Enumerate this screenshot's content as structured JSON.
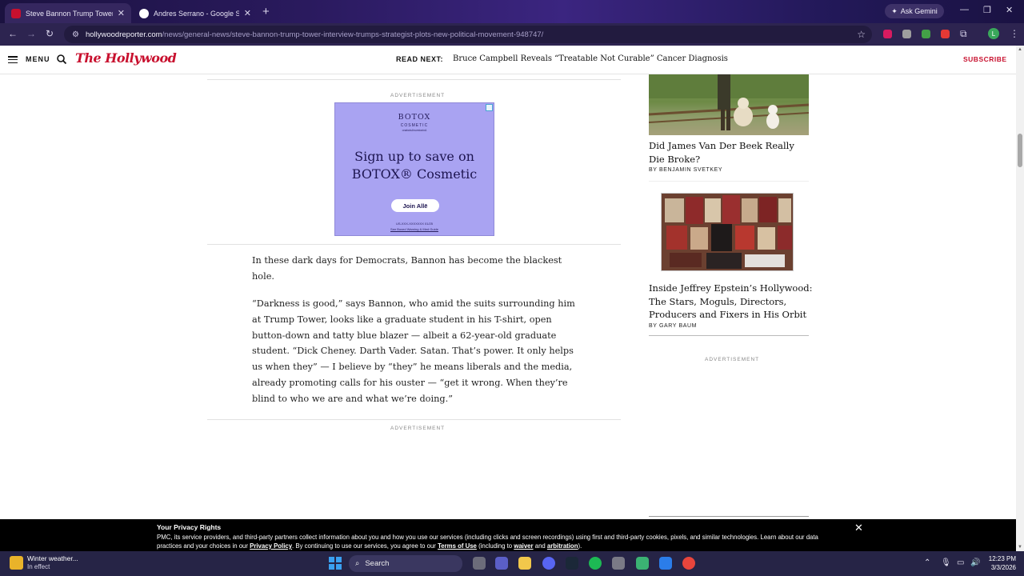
{
  "browser": {
    "tabs": [
      {
        "title": "Steve Bannon Trump Tower Inte",
        "active": true,
        "favicon_color": "#c8102e"
      },
      {
        "title": "Andres Serrano - Google Searc",
        "active": false,
        "favicon_color": "#4285f4"
      }
    ],
    "new_tab": "+",
    "gemini_label": "Ask Gemini",
    "url_domain": "hollywoodreporter.com",
    "url_path": "/news/general-news/steve-bannon-trump-tower-interview-trumps-strategist-plots-new-political-movement-948747/",
    "profile_initial": "L"
  },
  "site": {
    "menu_label": "MENU",
    "logo_text": "The Hollywood",
    "read_next_label": "READ NEXT:",
    "read_next_title": "Bruce Campbell Reveals “Treatable Not Curable” Cancer Diagnosis",
    "subscribe_label": "SUBSCRIBE"
  },
  "ad": {
    "label": "ADVERTISEMENT",
    "brand": "BOTOX",
    "brand_sub": "COSMETIC",
    "brand_fine": "onabotulinumtoxinA",
    "headline_line1": "Sign up to save on",
    "headline_line2": "BOTOX® Cosmetic",
    "cta": "Join Allē",
    "fine1": "US-XXX-XXXXXXX 01/25",
    "fine2": "See Boxed Warning & Med Guide"
  },
  "article": {
    "paragraphs": [
      "In these dark days for Democrats, Bannon has become the blackest hole.",
      "“Darkness is good,” says Bannon, who amid the suits surrounding him at Trump Tower, looks like a graduate student in his T-shirt, open button-down and tatty blue blazer — albeit a 62-year-old graduate student. “Dick Cheney. Darth Vader. Satan. That’s power. It only helps us when they” — I believe by “they” he means liberals and the media, already promoting calls for his ouster — “get it wrong. When they’re blind to who we are and what we’re doing.”"
    ],
    "ad_label_bottom": "ADVERTISEMENT"
  },
  "rail": {
    "stories": [
      {
        "title": "Did James Van Der Beek Really Die Broke?",
        "byline": "BY BENJAMIN SVETKEY"
      },
      {
        "title": "Inside Jeffrey Epstein’s Hollywood: The Stars, Moguls, Directors, Producers and Fixers in His Orbit",
        "byline": "BY GARY BAUM"
      }
    ],
    "ad_label": "ADVERTISEMENT"
  },
  "privacy": {
    "title": "Your Privacy Rights",
    "body_start": "PMC, its service providers, and third-party partners collect information about you and how you use our services (including clicks and screen recordings) using first and third-party cookies, pixels, and similar technologies. Learn about our data practices and your choices in our ",
    "privacy_policy": "Privacy Policy",
    "body_mid": ". By continuing to use our services, you agree to our ",
    "terms": "Terms of Use",
    "body_mid2": " (including to ",
    "waiver": "waiver",
    "and": " and ",
    "arbitration": "arbitration",
    "body_end": ").",
    "close": "✕"
  },
  "taskbar": {
    "weather_title": "Winter weather...",
    "weather_status": "In effect",
    "search_label": "Search",
    "time": "12:23 PM",
    "date": "3/3/2026"
  }
}
